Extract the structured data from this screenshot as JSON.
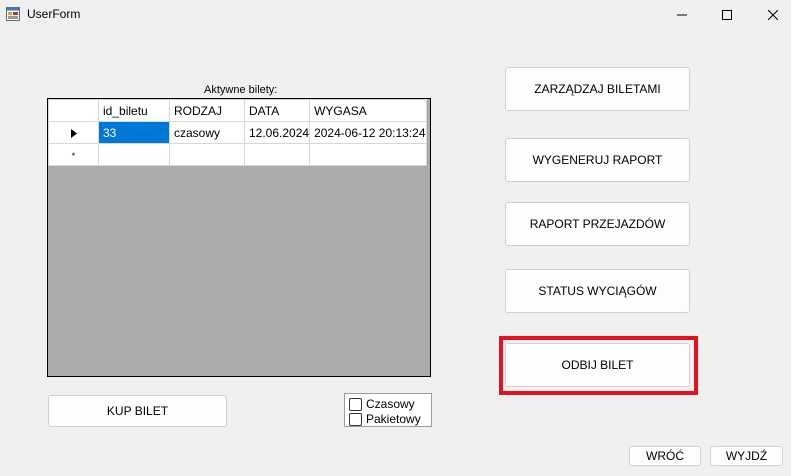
{
  "window": {
    "title": "UserForm",
    "icons": {
      "app": "app-icon",
      "minimize": "minimize-icon",
      "maximize": "maximize-icon",
      "close": "close-icon"
    }
  },
  "tickets": {
    "label": "Aktywne bilety:",
    "columns": [
      "id_biletu",
      "RODZAJ",
      "DATA",
      "WYGASA"
    ],
    "rows": [
      {
        "id_biletu": "33",
        "rodzaj": "czasowy",
        "data": "12.06.2024",
        "wygasa": "2024-06-12 20:13:24",
        "marker": "▶"
      }
    ],
    "new_row_marker": "*",
    "selected_cell": "id_biletu"
  },
  "buttons": {
    "manage": "ZARZĄDZAJ BILETAMI",
    "generate_report": "WYGENERUJ RAPORT",
    "rides_report": "RAPORT PRZEJAZDÓW",
    "lifts_status": "STATUS WYCIĄGÓW",
    "validate": "ODBIJ BILET",
    "buy": "KUP BILET",
    "back": "WRÓĆ",
    "exit": "WYJDŹ"
  },
  "filters": {
    "czasowy": {
      "label": "Czasowy",
      "checked": false
    },
    "pakietowy": {
      "label": "Pakietowy",
      "checked": false
    }
  },
  "colors": {
    "highlight": "#e3121e",
    "selection": "#0078d7",
    "grid_background": "#ababab"
  }
}
